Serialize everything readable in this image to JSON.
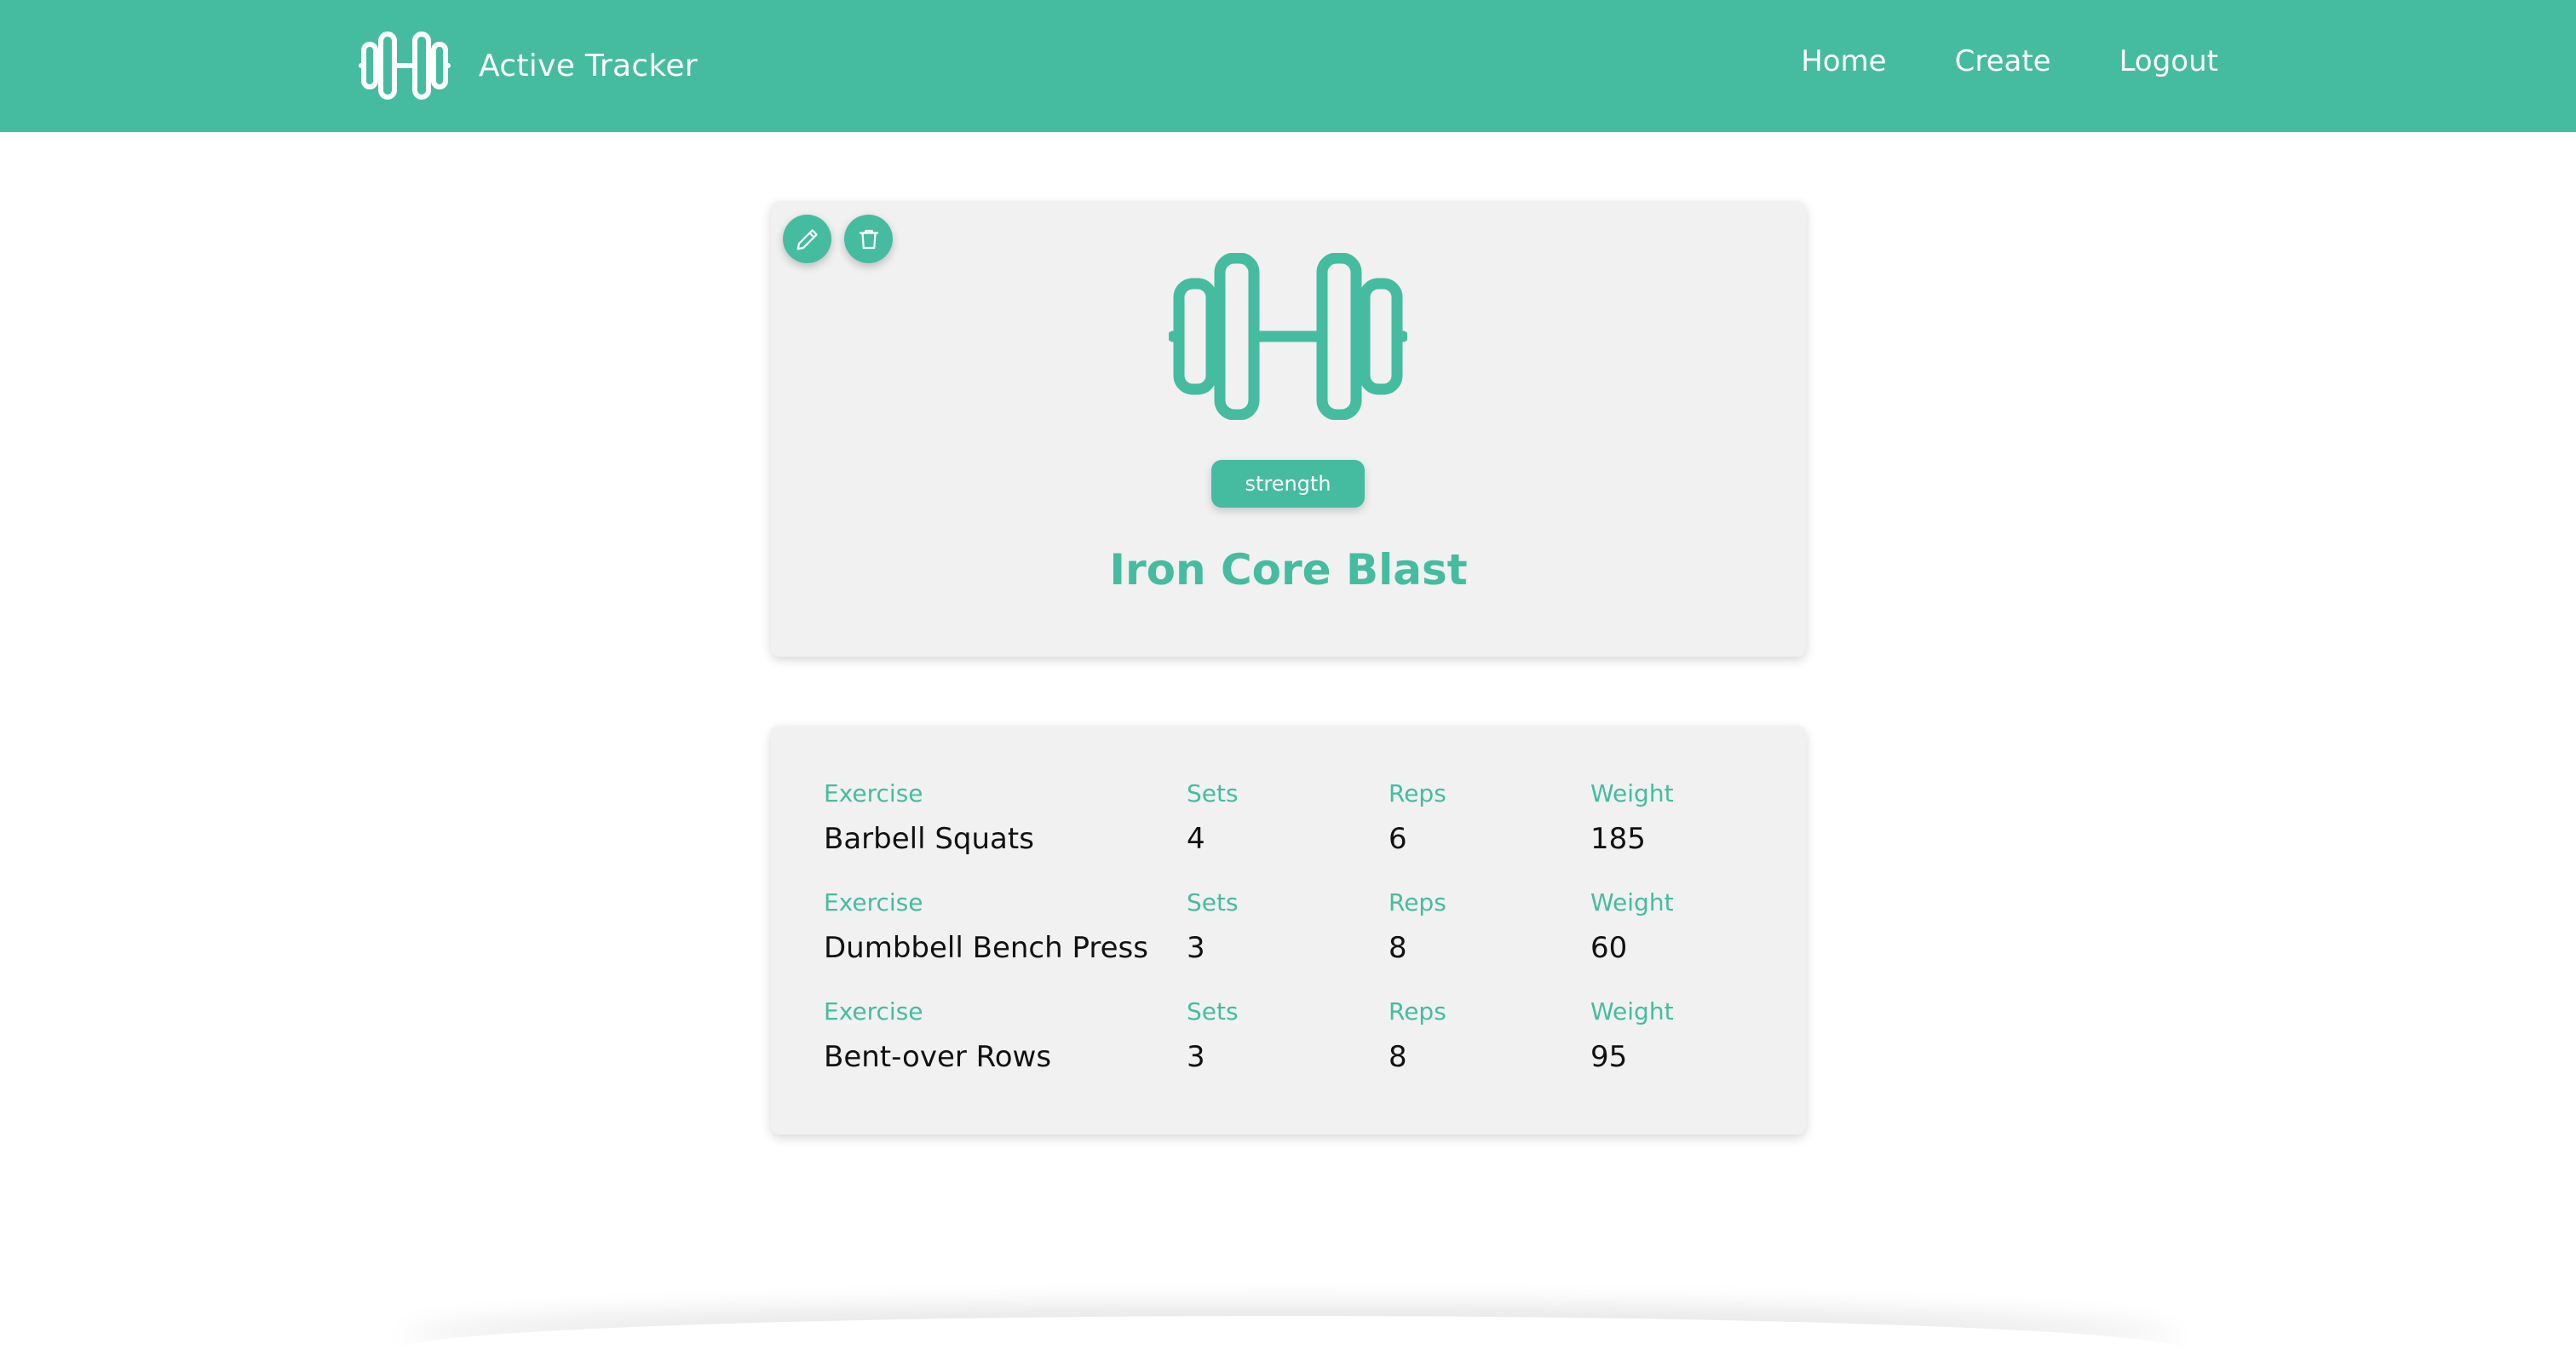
{
  "brand": {
    "title": "Active Tracker",
    "icon": "dumbbell-icon"
  },
  "nav": {
    "home": "Home",
    "create": "Create",
    "logout": "Logout"
  },
  "workout": {
    "category": "strength",
    "title": "Iron Core Blast",
    "icon": "dumbbell-icon",
    "actions": {
      "edit_icon": "pencil-icon",
      "delete_icon": "trash-icon"
    }
  },
  "table": {
    "labels": {
      "exercise": "Exercise",
      "sets": "Sets",
      "reps": "Reps",
      "weight": "Weight"
    },
    "rows": [
      {
        "exercise": "Barbell Squats",
        "sets": "4",
        "reps": "6",
        "weight": "185"
      },
      {
        "exercise": "Dumbbell Bench Press",
        "sets": "3",
        "reps": "8",
        "weight": "60"
      },
      {
        "exercise": "Bent-over Rows",
        "sets": "3",
        "reps": "8",
        "weight": "95"
      }
    ]
  },
  "colors": {
    "accent": "#45bca0",
    "card": "#f1f1f1",
    "text": "#111111"
  }
}
